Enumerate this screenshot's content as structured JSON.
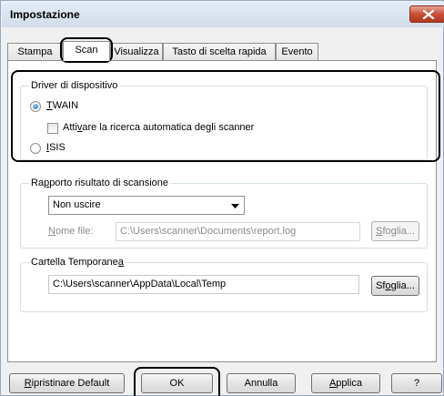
{
  "window": {
    "title": "Impostazione"
  },
  "tabs": [
    {
      "pre": "",
      "key": "",
      "post": "Stampa"
    },
    {
      "pre": "",
      "key": "",
      "post": "Scan"
    },
    {
      "pre": "",
      "key": "",
      "post": "Visualizza"
    },
    {
      "pre": "",
      "key": "",
      "post": "Tasto di scelta rapida"
    },
    {
      "pre": "",
      "key": "",
      "post": "Evento"
    }
  ],
  "driver": {
    "legend": "Driver di dispositivo",
    "twain": {
      "pre": "",
      "key": "T",
      "post": "WAIN",
      "selected": true
    },
    "auto_search": {
      "pre": "Atti",
      "key": "v",
      "post": "are la ricerca automatica degli scanner",
      "checked": false
    },
    "isis": {
      "pre": "",
      "key": "I",
      "post": "SIS",
      "selected": false
    }
  },
  "report": {
    "legend": {
      "pre": "Ra",
      "key": "p",
      "post": "porto risultato di scansione"
    },
    "select_value": "Non uscire",
    "file_label": {
      "pre": "",
      "key": "N",
      "post": "ome file:"
    },
    "file_value": "C:\\Users\\scanner\\Documents\\report.log",
    "browse": {
      "pre": "",
      "key": "S",
      "post": "foglia..."
    }
  },
  "temp": {
    "legend": {
      "pre": "Cartella Temporane",
      "key": "a",
      "post": ""
    },
    "path": "C:\\Users\\scanner\\AppData\\Local\\Temp",
    "browse": {
      "pre": "Sf",
      "key": "o",
      "post": "glia..."
    }
  },
  "footer": {
    "restore": {
      "pre": "",
      "key": "R",
      "post": "ipristinare Default"
    },
    "ok": "OK",
    "cancel": "Annulla",
    "apply": {
      "pre": "",
      "key": "A",
      "post": "pplica"
    },
    "help": "?"
  },
  "colors": {
    "accent": "#1a5fb4",
    "highlight": "#000000",
    "close": "#c75036"
  },
  "icons": {
    "close": "close-icon",
    "dropdown": "chevron-down-icon"
  }
}
